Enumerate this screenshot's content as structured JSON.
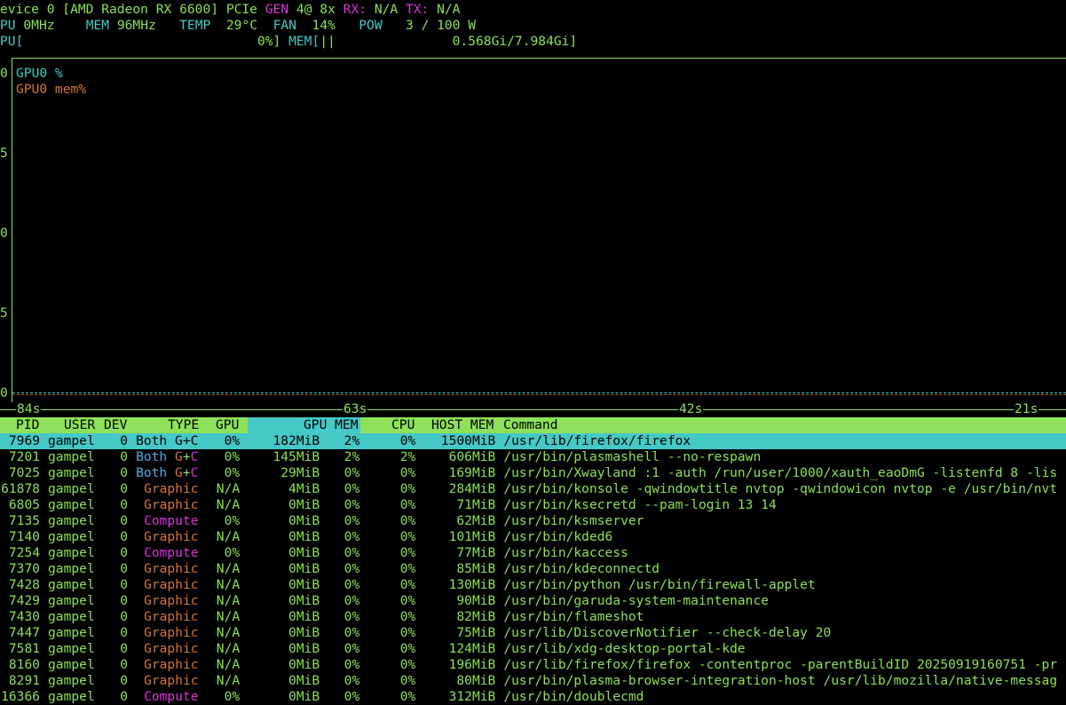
{
  "header": {
    "line1": {
      "device": "evice 0 [AMD Radeon RX 6600]",
      "pcie_label": "PCIe",
      "gen_label": "GEN",
      "gen_value": "4@ 8x",
      "rx_label": "RX:",
      "rx_value": "N/A",
      "tx_label": "TX:",
      "tx_value": "N/A"
    },
    "line2": {
      "gpu_clock_label": "PU",
      "gpu_clock_value": "0MHz",
      "mem_clock_label": "MEM",
      "mem_clock_value": "96MHz",
      "temp_label": "TEMP",
      "temp_value": "29°C",
      "fan_label": "FAN",
      "fan_value": "14%",
      "pow_label": "POW",
      "pow_value": "3 / 100 W"
    },
    "line3": {
      "gpu_bar_prefix": "PU[",
      "gpu_bar_value": "0%]",
      "mem_bar_prefix": "MEM[",
      "mem_bar_fill": "||",
      "mem_bar_value": "0.568Gi/7.984Gi]",
      "gpu_util_fraction": 0.0,
      "mem_util_fraction": 0.071
    }
  },
  "chart": {
    "y_ticks": [
      "0",
      "5",
      "0",
      "5",
      "0"
    ],
    "legend": [
      {
        "label": "GPU0 %",
        "color": "#44c9c6"
      },
      {
        "label": "GPU0 mem%",
        "color": "#d2763a"
      }
    ],
    "x_ticks": [
      "84s",
      "63s",
      "42s",
      "21s"
    ],
    "series_values": {
      "gpu_pct": 0,
      "mem_pct": 0
    }
  },
  "table": {
    "columns": {
      "pid": "PID",
      "user": "USER",
      "dev": "DEV",
      "type": "TYPE",
      "gpu": "GPU",
      "gpu_mem": "GPU MEM",
      "cpu": "CPU",
      "host_mem": "HOST MEM",
      "command": "Command"
    },
    "rows": [
      {
        "pid": "7969",
        "user": "gampel",
        "dev": "0",
        "type": "Both G+C",
        "gpu": "0%",
        "gpu_mem": "182MiB",
        "mem_pct": "2%",
        "cpu": "0%",
        "host_mem": "1500MiB",
        "command": "/usr/lib/firefox/firefox"
      },
      {
        "pid": "7201",
        "user": "gampel",
        "dev": "0",
        "type": "Both G+C",
        "gpu": "0%",
        "gpu_mem": "145MiB",
        "mem_pct": "2%",
        "cpu": "2%",
        "host_mem": "606MiB",
        "command": "/usr/bin/plasmashell --no-respawn"
      },
      {
        "pid": "7025",
        "user": "gampel",
        "dev": "0",
        "type": "Both G+C",
        "gpu": "0%",
        "gpu_mem": "29MiB",
        "mem_pct": "0%",
        "cpu": "0%",
        "host_mem": "169MiB",
        "command": "/usr/bin/Xwayland :1 -auth /run/user/1000/xauth_eaoDmG -listenfd 8 -lis"
      },
      {
        "pid": "61878",
        "user": "gampel",
        "dev": "0",
        "type": "Graphic",
        "gpu": "N/A",
        "gpu_mem": "4MiB",
        "mem_pct": "0%",
        "cpu": "0%",
        "host_mem": "284MiB",
        "command": "/usr/bin/konsole -qwindowtitle nvtop -qwindowicon nvtop -e /usr/bin/nvt"
      },
      {
        "pid": "6805",
        "user": "gampel",
        "dev": "0",
        "type": "Graphic",
        "gpu": "N/A",
        "gpu_mem": "0MiB",
        "mem_pct": "0%",
        "cpu": "0%",
        "host_mem": "71MiB",
        "command": "/usr/bin/ksecretd --pam-login 13 14"
      },
      {
        "pid": "7135",
        "user": "gampel",
        "dev": "0",
        "type": "Compute",
        "gpu": "0%",
        "gpu_mem": "0MiB",
        "mem_pct": "0%",
        "cpu": "0%",
        "host_mem": "62MiB",
        "command": "/usr/bin/ksmserver"
      },
      {
        "pid": "7140",
        "user": "gampel",
        "dev": "0",
        "type": "Graphic",
        "gpu": "N/A",
        "gpu_mem": "0MiB",
        "mem_pct": "0%",
        "cpu": "0%",
        "host_mem": "101MiB",
        "command": "/usr/bin/kded6"
      },
      {
        "pid": "7254",
        "user": "gampel",
        "dev": "0",
        "type": "Compute",
        "gpu": "0%",
        "gpu_mem": "0MiB",
        "mem_pct": "0%",
        "cpu": "0%",
        "host_mem": "77MiB",
        "command": "/usr/bin/kaccess"
      },
      {
        "pid": "7370",
        "user": "gampel",
        "dev": "0",
        "type": "Graphic",
        "gpu": "N/A",
        "gpu_mem": "0MiB",
        "mem_pct": "0%",
        "cpu": "0%",
        "host_mem": "85MiB",
        "command": "/usr/bin/kdeconnectd"
      },
      {
        "pid": "7428",
        "user": "gampel",
        "dev": "0",
        "type": "Graphic",
        "gpu": "N/A",
        "gpu_mem": "0MiB",
        "mem_pct": "0%",
        "cpu": "0%",
        "host_mem": "130MiB",
        "command": "/usr/bin/python /usr/bin/firewall-applet"
      },
      {
        "pid": "7429",
        "user": "gampel",
        "dev": "0",
        "type": "Graphic",
        "gpu": "N/A",
        "gpu_mem": "0MiB",
        "mem_pct": "0%",
        "cpu": "0%",
        "host_mem": "90MiB",
        "command": "/usr/bin/garuda-system-maintenance"
      },
      {
        "pid": "7430",
        "user": "gampel",
        "dev": "0",
        "type": "Graphic",
        "gpu": "N/A",
        "gpu_mem": "0MiB",
        "mem_pct": "0%",
        "cpu": "0%",
        "host_mem": "82MiB",
        "command": "/usr/bin/flameshot"
      },
      {
        "pid": "7447",
        "user": "gampel",
        "dev": "0",
        "type": "Graphic",
        "gpu": "N/A",
        "gpu_mem": "0MiB",
        "mem_pct": "0%",
        "cpu": "0%",
        "host_mem": "75MiB",
        "command": "/usr/lib/DiscoverNotifier --check-delay 20"
      },
      {
        "pid": "7581",
        "user": "gampel",
        "dev": "0",
        "type": "Graphic",
        "gpu": "N/A",
        "gpu_mem": "0MiB",
        "mem_pct": "0%",
        "cpu": "0%",
        "host_mem": "124MiB",
        "command": "/usr/lib/xdg-desktop-portal-kde"
      },
      {
        "pid": "8160",
        "user": "gampel",
        "dev": "0",
        "type": "Graphic",
        "gpu": "N/A",
        "gpu_mem": "0MiB",
        "mem_pct": "0%",
        "cpu": "0%",
        "host_mem": "196MiB",
        "command": "/usr/lib/firefox/firefox -contentproc -parentBuildID 20250919160751 -pr"
      },
      {
        "pid": "8291",
        "user": "gampel",
        "dev": "0",
        "type": "Graphic",
        "gpu": "N/A",
        "gpu_mem": "0MiB",
        "mem_pct": "0%",
        "cpu": "0%",
        "host_mem": "80MiB",
        "command": "/usr/bin/plasma-browser-integration-host /usr/lib/mozilla/native-messag"
      },
      {
        "pid": "16366",
        "user": "gampel",
        "dev": "0",
        "type": "Compute",
        "gpu": "0%",
        "gpu_mem": "0MiB",
        "mem_pct": "0%",
        "cpu": "0%",
        "host_mem": "312MiB",
        "command": "/usr/bin/doublecmd"
      }
    ],
    "selected_index": 0
  },
  "colors": {
    "text": "#8ee05a",
    "magenta": "#d936d9",
    "cyan": "#44c9c6",
    "orange": "#d2763a",
    "blue": "#5aa8e0"
  }
}
